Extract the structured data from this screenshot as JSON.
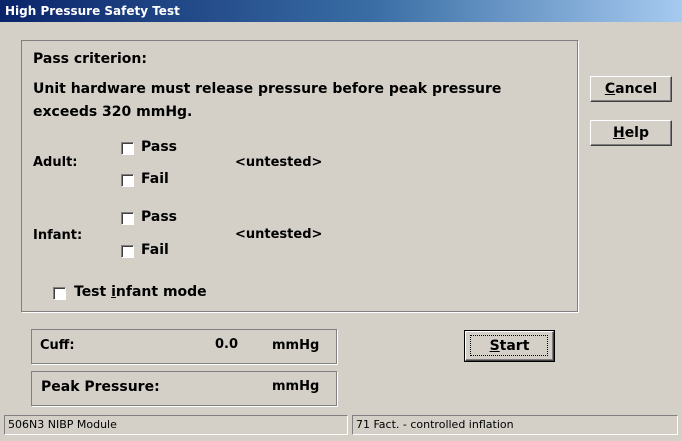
{
  "window": {
    "title": "High Pressure Safety Test"
  },
  "criterion": {
    "heading": "Pass criterion:",
    "line1": "Unit hardware must release pressure before peak pressure",
    "line2": "exceeds 320 mmHg."
  },
  "adult": {
    "label": "Adult:",
    "pass_label": "Pass",
    "fail_label": "Fail",
    "pass_checked": false,
    "fail_checked": false,
    "status": "<untested>"
  },
  "infant": {
    "label": "Infant:",
    "pass_label": "Pass",
    "fail_label": "Fail",
    "pass_checked": false,
    "fail_checked": false,
    "status": "<untested>"
  },
  "test_infant_mode": {
    "label_prefix": "Test ",
    "label_mnemonic": "i",
    "label_suffix": "nfant mode",
    "checked": false
  },
  "buttons": {
    "cancel": {
      "mnemonic": "C",
      "rest": "ancel"
    },
    "help": {
      "mnemonic": "H",
      "rest": "elp"
    },
    "start": {
      "mnemonic": "S",
      "rest": "tart"
    }
  },
  "cuff": {
    "label": "Cuff:",
    "value": "0.0",
    "unit": "mmHg"
  },
  "peak": {
    "label": "Peak Pressure:",
    "value": "",
    "unit": "mmHg"
  },
  "status_bar": {
    "module": "506N3 NIBP Module",
    "message": "71 Fact. - controlled inflation"
  }
}
